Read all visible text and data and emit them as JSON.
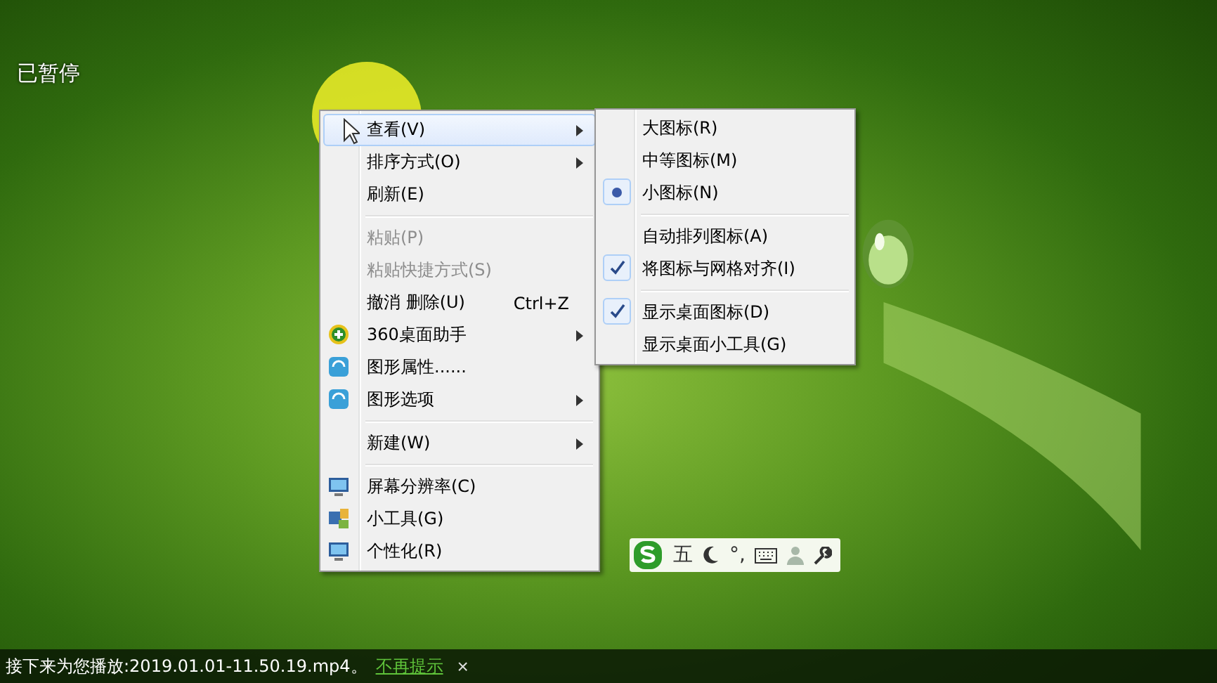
{
  "player": {
    "status": "已暂停"
  },
  "context_menu": {
    "items": [
      {
        "kind": "item",
        "label": "查看(V)",
        "submenu": true,
        "selected": true,
        "disabled": false
      },
      {
        "kind": "item",
        "label": "排序方式(O)",
        "submenu": true,
        "selected": false,
        "disabled": false
      },
      {
        "kind": "item",
        "label": "刷新(E)",
        "submenu": false,
        "selected": false,
        "disabled": false
      },
      {
        "kind": "separator"
      },
      {
        "kind": "item",
        "label": "粘贴(P)",
        "submenu": false,
        "selected": false,
        "disabled": true
      },
      {
        "kind": "item",
        "label": "粘贴快捷方式(S)",
        "submenu": false,
        "selected": false,
        "disabled": true
      },
      {
        "kind": "item",
        "label": "撤消 删除(U)",
        "shortcut": "Ctrl+Z",
        "submenu": false,
        "selected": false,
        "disabled": false
      },
      {
        "kind": "assistant",
        "label": "360桌面助手",
        "submenu": true,
        "selected": false,
        "disabled": false
      },
      {
        "kind": "graphics",
        "label": "图形属性......",
        "submenu": false,
        "selected": false,
        "disabled": false
      },
      {
        "kind": "graphics",
        "label": "图形选项",
        "submenu": true,
        "selected": false,
        "disabled": false
      },
      {
        "kind": "separator"
      },
      {
        "kind": "item",
        "label": "新建(W)",
        "submenu": true,
        "selected": false,
        "disabled": false
      },
      {
        "kind": "separator"
      },
      {
        "kind": "display",
        "label": "屏幕分辨率(C)",
        "submenu": false,
        "selected": false,
        "disabled": false
      },
      {
        "kind": "gadgets",
        "label": "小工具(G)",
        "submenu": false,
        "selected": false,
        "disabled": false
      },
      {
        "kind": "display",
        "label": "个性化(R)",
        "submenu": false,
        "selected": false,
        "disabled": false
      }
    ]
  },
  "view_submenu": {
    "items": [
      {
        "kind": "radio",
        "label": "大图标(R)",
        "checked": false
      },
      {
        "kind": "radio",
        "label": "中等图标(M)",
        "checked": false
      },
      {
        "kind": "radio",
        "label": "小图标(N)",
        "checked": true
      },
      {
        "kind": "separator"
      },
      {
        "kind": "check",
        "label": "自动排列图标(A)",
        "checked": false
      },
      {
        "kind": "check",
        "label": "将图标与网格对齐(I)",
        "checked": true
      },
      {
        "kind": "separator"
      },
      {
        "kind": "check",
        "label": "显示桌面图标(D)",
        "checked": true
      },
      {
        "kind": "check",
        "label": "显示桌面小工具(G)",
        "checked": false
      }
    ]
  },
  "ime_bar": {
    "items": [
      {
        "kind": "logo"
      },
      {
        "kind": "text",
        "label": "五"
      },
      {
        "kind": "moon"
      },
      {
        "kind": "text",
        "label": "°,"
      },
      {
        "kind": "keyboard"
      },
      {
        "kind": "person"
      },
      {
        "kind": "wrench"
      }
    ]
  },
  "notice_bar": {
    "text": "接下来为您播放:2019.01.01-11.50.19.mp4。",
    "link": "不再提示",
    "close": "×"
  }
}
